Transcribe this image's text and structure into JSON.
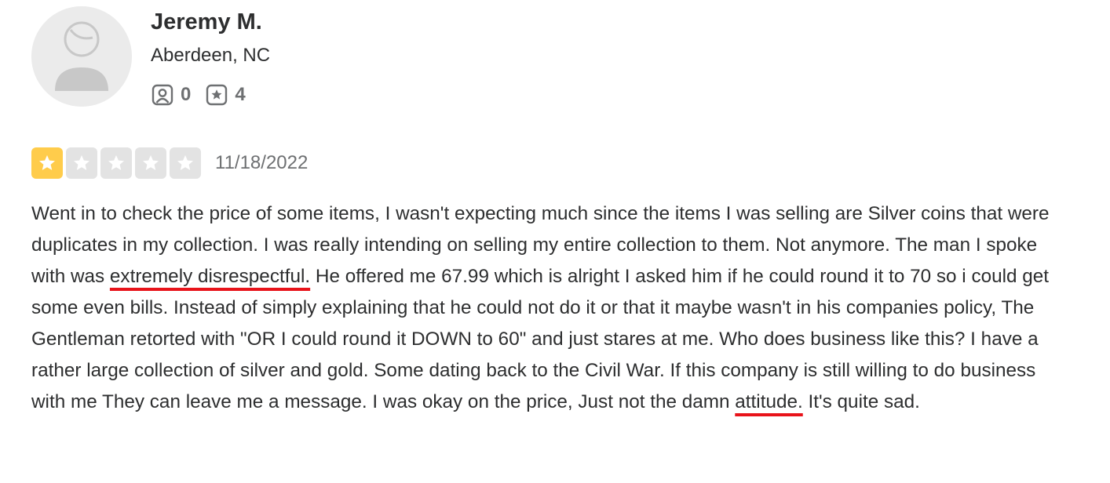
{
  "reviewer": {
    "name": "Jeremy M.",
    "location": "Aberdeen, NC",
    "friends_count": "0",
    "reviews_count": "4"
  },
  "review": {
    "rating": 1,
    "max_rating": 5,
    "date": "11/18/2022",
    "text_part1": "Went in to check the price of some items, I wasn't expecting much since the items I was selling are Silver coins that were duplicates in my collection. I was really intending on selling my entire collection to them. Not anymore. The man I spoke with was ",
    "highlight1": "extremely disrespectful.",
    "text_part2": " He offered me 67.99 which is alright I asked him if he could round it to 70 so i could get some even bills. Instead of simply explaining that he could not do it or that it maybe wasn't in his companies policy, The Gentleman retorted with \"OR I could round it DOWN to 60\" and just stares at me. Who does business like this? I have a rather large collection of silver and gold. Some dating back to the Civil War. If this company is still willing to do business with me They can leave me a message. I was okay on the price, Just not the damn ",
    "highlight2": "attitude.",
    "text_part3": " It's quite sad."
  },
  "icons": {
    "avatar": "default-user-avatar",
    "friends": "friends-icon",
    "reviews": "reviews-star-icon",
    "star": "star-icon"
  },
  "colors": {
    "star_filled": "#ffcc4b",
    "star_empty": "#e3e3e3",
    "annotation_underline": "#e8131a"
  }
}
